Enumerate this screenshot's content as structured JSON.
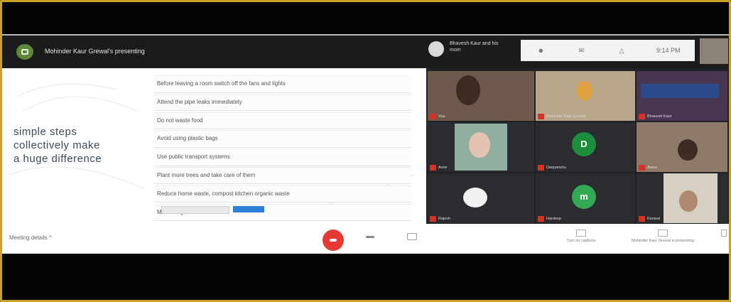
{
  "header": {
    "presenting_text": "Mohinder Kaur Grewal's presenting",
    "self_name": "Bhavesh Kaur and his mom",
    "time": "9:14 PM"
  },
  "slide": {
    "tagline_line1": "simple steps",
    "tagline_line2": "collectively make",
    "tagline_line3": "a huge difference",
    "steps": [
      "Before leaving a room switch off the fans and lights",
      "Attend the pipe leaks immediately",
      "Do not waste food",
      "Avoid using plastic bags",
      "Use public transport systems",
      "Plant more trees and take care of them",
      "Reduce home waste, compost kitchen organic waste",
      "Maintain gardens"
    ]
  },
  "participants": [
    {
      "name": "Vaa"
    },
    {
      "name": "Mohinder Kaur Grewal"
    },
    {
      "name": "Bhavesh Kaur"
    },
    {
      "name": "Avee"
    },
    {
      "name": "Deepanshu",
      "initial": "D",
      "color": "#1e8e3e"
    },
    {
      "name": "Aarav"
    },
    {
      "name": "Rajesh"
    },
    {
      "name": "Hardeep",
      "initial": "m",
      "color": "#34a853"
    },
    {
      "name": "Kanwal"
    }
  ],
  "bottombar": {
    "meeting_details": "Meeting details  ^",
    "captions_label": "Turn on captions",
    "presenting_label": "Mohinder Kaur Grewal is presenting"
  },
  "colors": {
    "frame": "#c9a227",
    "hangup": "#e53935",
    "mic_off": "#d93025",
    "slide_button": "#2d7fd8"
  }
}
